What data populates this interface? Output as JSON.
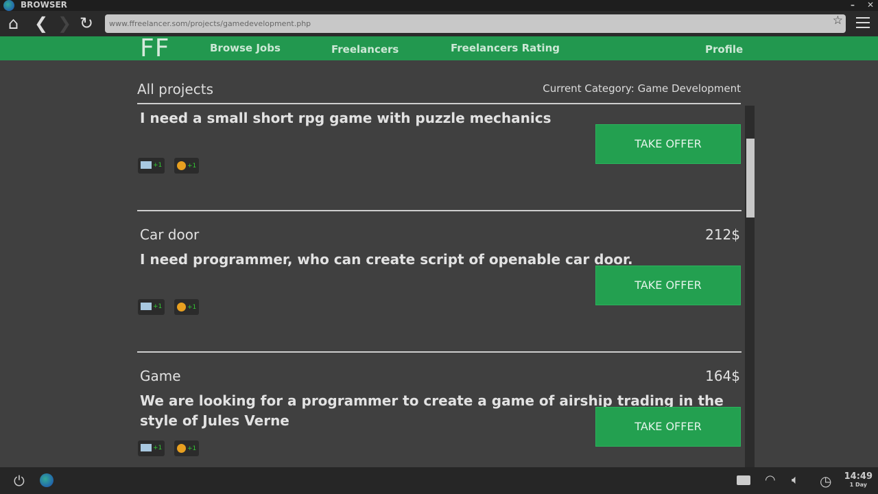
{
  "window": {
    "title": "BROWSER",
    "minimize": "–",
    "close": "✕"
  },
  "toolbar": {
    "url": "www.ffreelancer.som/projects/gamedevelopment.php"
  },
  "site": {
    "logo": "FF",
    "nav": [
      "Browse Jobs",
      "Freelancers",
      "Freelancers Rating",
      "Profile"
    ]
  },
  "header": {
    "title": "All projects",
    "category": "Current Category: Game Development"
  },
  "projects": [
    {
      "title": "",
      "price": "",
      "description": "I need a small short rpg game with puzzle mechanics",
      "tags": [
        "+1",
        "+1"
      ],
      "button": "TAKE OFFER"
    },
    {
      "title": "Car door",
      "price": "212$",
      "description": "I need programmer, who can create script of openable car door.",
      "tags": [
        "+1",
        "+1"
      ],
      "button": "TAKE OFFER"
    },
    {
      "title": "Game",
      "price": "164$",
      "description": "We are looking for a programmer to create a game of airship trading in the style of Jules Verne",
      "tags": [
        "+1",
        "+1"
      ],
      "button": "TAKE OFFER"
    }
  ],
  "taskbar": {
    "time": "14:49",
    "day": "1 Day"
  },
  "colors": {
    "accent": "#22984f",
    "button": "#23a050",
    "background": "#404040"
  }
}
